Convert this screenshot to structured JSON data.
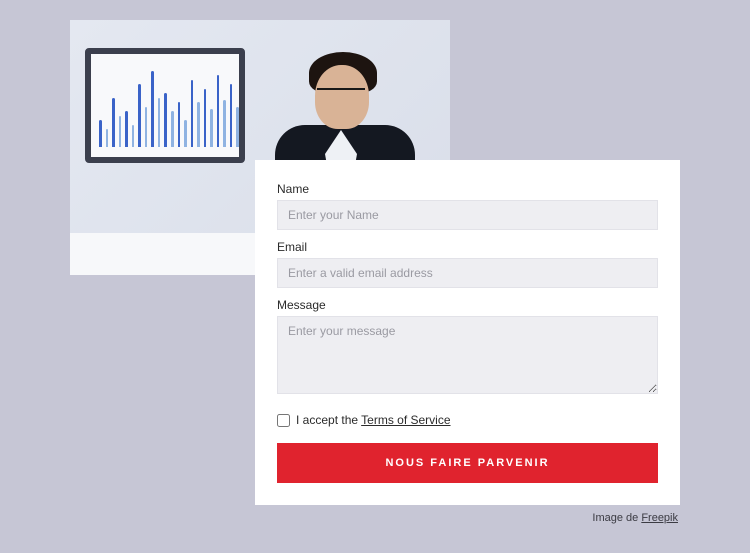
{
  "form": {
    "name_label": "Name",
    "name_placeholder": "Enter your Name",
    "email_label": "Email",
    "email_placeholder": "Enter a valid email address",
    "message_label": "Message",
    "message_placeholder": "Enter your message",
    "terms_prefix": "I accept the ",
    "terms_link": "Terms of Service",
    "submit_label": "NOUS FAIRE PARVENIR"
  },
  "credit": {
    "prefix": "Image de ",
    "link_text": "Freepik"
  },
  "chart_data": {
    "type": "bar",
    "title": "",
    "xlabel": "",
    "ylabel": "",
    "categories": [
      "1",
      "2",
      "3",
      "4",
      "5",
      "6",
      "7",
      "8",
      "9",
      "10",
      "11"
    ],
    "series": [
      {
        "name": "dark",
        "values": [
          30,
          55,
          40,
          70,
          85,
          60,
          50,
          75,
          65,
          80,
          70
        ]
      },
      {
        "name": "light",
        "values": [
          20,
          35,
          25,
          45,
          55,
          40,
          30,
          50,
          42,
          52,
          45
        ]
      }
    ],
    "ylim": [
      0,
      100
    ]
  }
}
